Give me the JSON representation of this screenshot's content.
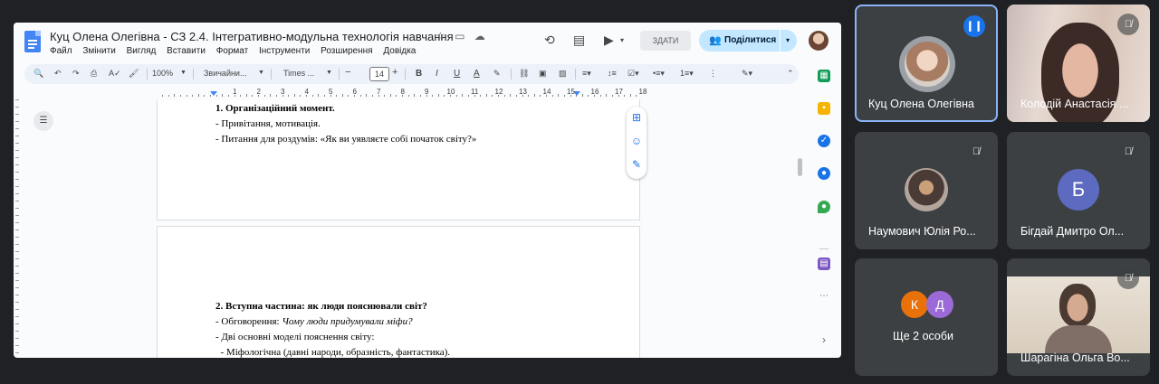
{
  "doc": {
    "title": "Куц Олена Олегівна - СЗ 2.4. Інтегративно-модульна технологія навчання",
    "menu": [
      "Файл",
      "Змінити",
      "Вигляд",
      "Вставити",
      "Формат",
      "Інструменти",
      "Розширення",
      "Довідка"
    ],
    "zdaty_label": "ЗДАТИ",
    "share_label": "Поділитися",
    "toolbar": {
      "zoom": "100%",
      "style": "Звичайни...",
      "font": "Times ...",
      "font_size": "14",
      "ruler_numbers": [
        "1",
        "2",
        "3",
        "4",
        "5",
        "6",
        "7",
        "8",
        "9",
        "10",
        "11",
        "12",
        "13",
        "14",
        "15",
        "16",
        "17",
        "18"
      ]
    },
    "content": {
      "p1_heading": "1. Організаційний момент.",
      "p1_line1": "- Привітання, мотивація.",
      "p1_line2": "- Питання для роздумів: «Як ви уявляєте собі початок світу?»",
      "p2_heading": "2. Вступна частина: як люди пояснювали світ?",
      "p2_line1_prefix": "- Обговорення: ",
      "p2_line1_italic": "Чому люди придумували міфи?",
      "p2_line2": "- Дві основні моделі пояснення світу:",
      "p2_line3": "  - Міфологічна (давні народи, образність, фантастика)."
    }
  },
  "participants": {
    "tile1": {
      "name": "Куц Олена Олегівна",
      "speaking": true
    },
    "tile2": {
      "name": "Колодій Анастасія ...",
      "muted": true
    },
    "tile3": {
      "name": "Наумович Юлія Ро...",
      "muted": true
    },
    "tile4": {
      "name": "Бігдай Дмитро Ол...",
      "initial": "Б",
      "muted": true
    },
    "tile5": {
      "name": "Ще 2 особи",
      "initials": [
        "К",
        "Д"
      ]
    },
    "tile6": {
      "name": "Шарагіна Ольга Во...",
      "muted": true
    }
  },
  "colors": {
    "background": "#202124",
    "tile": "#3c4043",
    "active_border": "#8ab4f8",
    "share_button": "#c2e7ff",
    "avatar_b": "#5c6bc0",
    "avatar_k": "#e8710a",
    "avatar_d": "#9c6ad6"
  }
}
